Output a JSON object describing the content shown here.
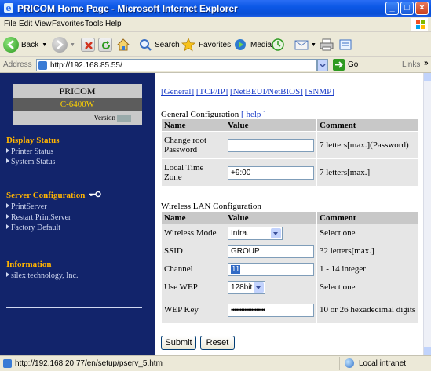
{
  "window": {
    "title": "PRICOM Home Page - Microsoft Internet Explorer",
    "minimize": "_",
    "maximize": "□",
    "close": "×"
  },
  "menu": [
    "File",
    "Edit",
    "View",
    "Favorites",
    "Tools",
    "Help"
  ],
  "toolbar": {
    "back": "Back",
    "search": "Search",
    "favorites": "Favorites",
    "media": "Media"
  },
  "address": {
    "label": "Address",
    "url": "http://192.168.85.55/",
    "go": "Go",
    "links": "Links",
    "more": "»"
  },
  "sidebar": {
    "brand": "PRICOM",
    "model": "C-6400W",
    "version_label": "Version",
    "display_status": {
      "heading": "Display Status",
      "items": [
        "Printer Status",
        "System Status"
      ]
    },
    "server_config": {
      "heading": "Server Configuration",
      "items": [
        "PrintServer",
        "Restart PrintServer",
        "Factory Default"
      ]
    },
    "information": {
      "heading": "Information",
      "items": [
        "silex technology, Inc."
      ]
    }
  },
  "main": {
    "tabs": [
      "[General]",
      "[TCP/IP]",
      "[NetBEUI/NetBIOS]",
      "[SNMP]"
    ],
    "general": {
      "title": "General Configuration",
      "help": "[ help ]",
      "headers": [
        "Name",
        "Value",
        "Comment"
      ],
      "rows": [
        {
          "name": "Change root Password",
          "value": "",
          "comment": "7 letters[max.](Password)"
        },
        {
          "name": "Local Time Zone",
          "value": "+9:00",
          "comment": "7 letters[max.]"
        }
      ]
    },
    "wireless": {
      "title": "Wireless LAN Configuration",
      "headers": [
        "Name",
        "Value",
        "Comment"
      ],
      "rows": [
        {
          "name": "Wireless Mode",
          "value": "Infra.",
          "comment": "Select one"
        },
        {
          "name": "SSID",
          "value": "GROUP",
          "comment": "32 letters[max.]"
        },
        {
          "name": "Channel",
          "value": "11",
          "comment": "1 - 14 integer"
        },
        {
          "name": "Use WEP",
          "value": "128bit",
          "comment": "Select one"
        },
        {
          "name": "WEP Key",
          "value": "••••••••••••••••••••",
          "comment": "10 or 26 hexadecimal digits"
        }
      ]
    },
    "submit": "Submit",
    "reset": "Reset"
  },
  "status": {
    "url": "http://192.168.20.77/en/setup/pserv_5.htm",
    "zone": "Local intranet"
  }
}
